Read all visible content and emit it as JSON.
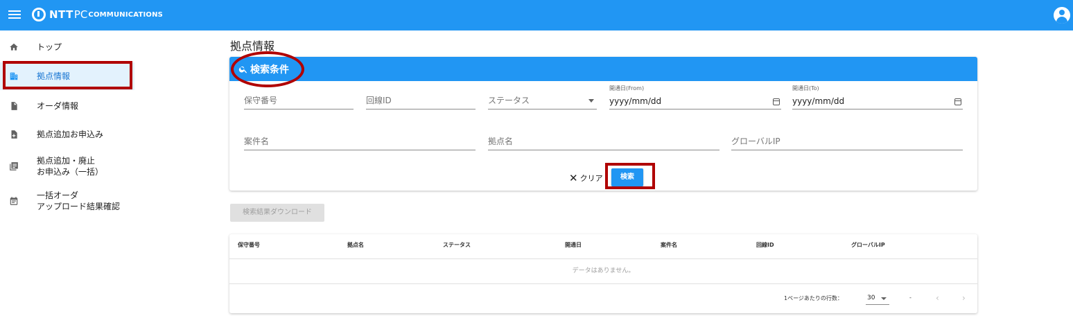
{
  "header": {
    "logo_ntt": "NTT",
    "logo_pc": "PC",
    "logo_comm": "COMMUNICATIONS"
  },
  "sidebar": {
    "items": [
      {
        "label": "トップ",
        "icon": "home-icon"
      },
      {
        "label": "拠点情報",
        "icon": "building-icon"
      },
      {
        "label": "オーダ情報",
        "icon": "document-icon"
      },
      {
        "label": "拠点追加お申込み",
        "icon": "add-document-icon"
      },
      {
        "label": "拠点追加・廃止\nお申込み（一括）",
        "icon": "library-icon"
      },
      {
        "label": "一括オーダ\nアップロード結果確認",
        "icon": "calendar-list-icon"
      }
    ]
  },
  "main": {
    "page_title": "拠点情報",
    "search_card": {
      "title": "検索条件",
      "fields": {
        "maintenance_no": "保守番号",
        "line_id": "回線ID",
        "status": "ステータス",
        "open_from_label": "開通日(From)",
        "open_from_value": "yyyy/mm/dd",
        "open_to_label": "開通日(To)",
        "open_to_value": "yyyy/mm/dd",
        "case_name": "案件名",
        "site_name": "拠点名",
        "global_ip": "グローバルIP"
      },
      "clear_label": "クリア",
      "search_label": "検索"
    },
    "download_label": "検索結果ダウンロード",
    "table": {
      "columns": [
        "保守番号",
        "拠点名",
        "ステータス",
        "開通日",
        "案件名",
        "回線ID",
        "グローバルIP"
      ],
      "no_data": "データはありません。",
      "rows_per_page_label": "1ページあたりの行数：",
      "rows_per_page_value": "30",
      "range": "-",
      "prev": "‹",
      "next": "›"
    }
  },
  "colors": {
    "primary": "#2196f3",
    "highlight": "#b00000",
    "active_bg": "#e3f2fd"
  }
}
